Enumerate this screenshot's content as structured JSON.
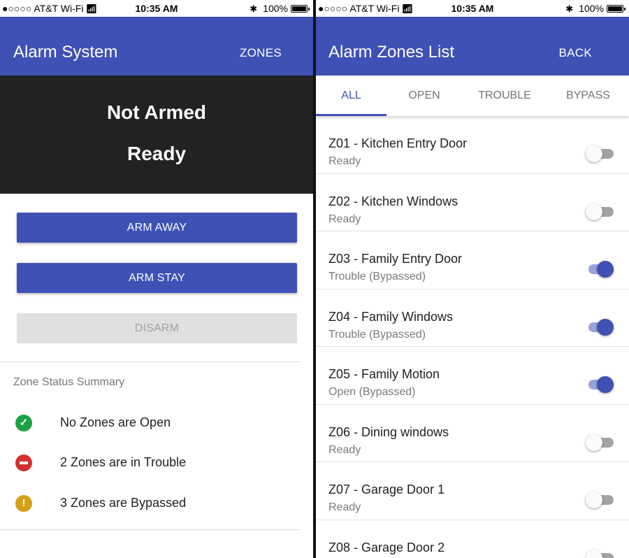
{
  "status_bar": {
    "carrier": "●○○○○ AT&T Wi-Fi",
    "time": "10:35 AM",
    "battery": "100%",
    "wifi_icon": "wifi-icon",
    "bluetooth_icon": "bluetooth-icon"
  },
  "left": {
    "app_bar": {
      "title": "Alarm System",
      "action": "ZONES"
    },
    "status": {
      "armed": "Not Armed",
      "ready": "Ready"
    },
    "buttons": {
      "arm_away": "ARM AWAY",
      "arm_stay": "ARM STAY",
      "disarm": "DISARM"
    },
    "summary": {
      "heading": "Zone Status Summary",
      "items": [
        {
          "icon": "check-circle-icon",
          "color": "#1aa245",
          "label": "No Zones are Open"
        },
        {
          "icon": "minus-circle-icon",
          "color": "#d32f2f",
          "label": "2 Zones are in Trouble"
        },
        {
          "icon": "warning-circle-icon",
          "color": "#d4a017",
          "label": "3 Zones are Bypassed"
        }
      ]
    }
  },
  "right": {
    "app_bar": {
      "title": "Alarm Zones List",
      "action": "BACK"
    },
    "tabs": [
      {
        "label": "ALL",
        "active": true
      },
      {
        "label": "OPEN",
        "active": false
      },
      {
        "label": "TROUBLE",
        "active": false
      },
      {
        "label": "BYPASS",
        "active": false
      }
    ],
    "zones": [
      {
        "name": "Z01 - Kitchen Entry Door",
        "status": "Ready",
        "bypassed": false
      },
      {
        "name": "Z02 - Kitchen Windows",
        "status": "Ready",
        "bypassed": false
      },
      {
        "name": "Z03 - Family Entry Door",
        "status": "Trouble (Bypassed)",
        "bypassed": true
      },
      {
        "name": "Z04 - Family Windows",
        "status": "Trouble (Bypassed)",
        "bypassed": true
      },
      {
        "name": "Z05 - Family Motion",
        "status": "Open (Bypassed)",
        "bypassed": true
      },
      {
        "name": "Z06 - Dining windows",
        "status": "Ready",
        "bypassed": false
      },
      {
        "name": "Z07 - Garage Door 1",
        "status": "Ready",
        "bypassed": false
      },
      {
        "name": "Z08 - Garage Door 2",
        "status": "",
        "bypassed": false
      }
    ]
  },
  "colors": {
    "primary": "#3f51b5",
    "status_panel_bg": "#222222",
    "disabled_bg": "#e0e0e0"
  }
}
